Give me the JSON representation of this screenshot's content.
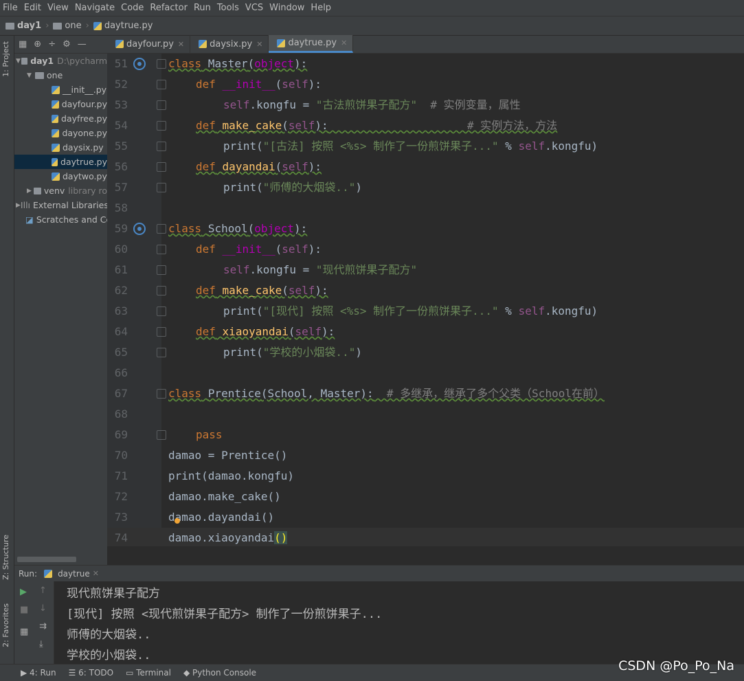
{
  "menu": [
    "File",
    "Edit",
    "View",
    "Navigate",
    "Code",
    "Refactor",
    "Run",
    "Tools",
    "VCS",
    "Window",
    "Help"
  ],
  "breadcrumb": {
    "project": "day1",
    "folder": "one",
    "file": "daytrue.py"
  },
  "side_tabs": {
    "project": "1: Project",
    "structure": "Z: Structure",
    "favorites": "2: Favorites"
  },
  "tree": [
    {
      "label": "day1",
      "extra": "D:\\pycharm",
      "type": "root"
    },
    {
      "label": "one",
      "type": "folder"
    },
    {
      "label": "__init__.py",
      "type": "file"
    },
    {
      "label": "dayfour.py",
      "type": "file"
    },
    {
      "label": "dayfree.py",
      "type": "file"
    },
    {
      "label": "dayone.py",
      "type": "file"
    },
    {
      "label": "daysix.py",
      "type": "file"
    },
    {
      "label": "daytrue.py",
      "type": "file",
      "selected": true
    },
    {
      "label": "daytwo.py",
      "type": "file"
    },
    {
      "label": "venv",
      "extra": "library ro",
      "type": "folder"
    },
    {
      "label": "External Libraries",
      "type": "lib"
    },
    {
      "label": "Scratches and Co",
      "type": "scratch"
    }
  ],
  "tabs": [
    "dayfour.py",
    "daysix.py",
    "daytrue.py"
  ],
  "active_tab": "daytrue.py",
  "line_numbers": [
    "51",
    "52",
    "53",
    "54",
    "55",
    "56",
    "57",
    "58",
    "59",
    "60",
    "61",
    "62",
    "63",
    "64",
    "65",
    "66",
    "67",
    "68",
    "69",
    "70",
    "71",
    "72",
    "73",
    "74"
  ],
  "console": {
    "run_label": "Run:",
    "run_config": "daytrue",
    "lines": [
      "现代煎饼果子配方",
      "[现代] 按照 <现代煎饼果子配方> 制作了一份煎饼果子...",
      "师傅的大烟袋..",
      "学校的小烟袋.."
    ]
  },
  "status_tabs": [
    "4: Run",
    "6: TODO",
    "Terminal",
    "Python Console"
  ],
  "watermark": "CSDN @Po_Po_Na",
  "colors": {
    "keyword": "#cc7832",
    "function": "#ffc66d",
    "self": "#94558d",
    "string": "#6a8759",
    "comment": "#808080",
    "accent": "#4a88c7"
  },
  "code": {
    "l51": {
      "kw": "class",
      "name": "Master",
      "open": "(",
      "base": "object",
      "close": "):"
    },
    "l52": {
      "kw": "def",
      "name": "__init__",
      "open": "(",
      "self": "self",
      "close": "):"
    },
    "l53": {
      "self": "self",
      "attr": ".kongfu = ",
      "str": "\"古法煎饼果子配方\"",
      "comment": "  # 实例变量，属性"
    },
    "l54": {
      "kw": "def",
      "name": "make_cake",
      "open": "(",
      "self": "self",
      "close": "):",
      "comment": "                     # 实例方法，方法"
    },
    "l55": {
      "pre": "print(",
      "str": "\"[古法] 按照 <%s> 制作了一份煎饼果子...\"",
      "mid": " % ",
      "self": "self",
      "post": ".kongfu)"
    },
    "l56": {
      "kw": "def",
      "name": "dayandai",
      "open": "(",
      "self": "self",
      "close": "):"
    },
    "l57": {
      "pre": "print(",
      "str": "\"师傅的大烟袋..\"",
      "post": ")"
    },
    "l59": {
      "kw": "class",
      "name": "School",
      "open": "(",
      "base": "object",
      "close": "):"
    },
    "l60": {
      "kw": "def",
      "name": "__init__",
      "open": "(",
      "self": "self",
      "close": "):"
    },
    "l61": {
      "self": "self",
      "attr": ".kongfu = ",
      "str": "\"现代煎饼果子配方\""
    },
    "l62": {
      "kw": "def",
      "name": "make_cake",
      "open": "(",
      "self": "self",
      "close": "):"
    },
    "l63": {
      "pre": "print(",
      "str": "\"[现代] 按照 <%s> 制作了一份煎饼果子...\"",
      "mid": " % ",
      "self": "self",
      "post": ".kongfu)"
    },
    "l64": {
      "kw": "def",
      "name": "xiaoyandai",
      "open": "(",
      "self": "self",
      "close": "):"
    },
    "l65": {
      "pre": "print(",
      "str": "\"学校的小烟袋..\"",
      "post": ")"
    },
    "l67": {
      "kw": "class",
      "name": "Prentice",
      "open": "(School, Master):",
      "comment": "  # 多继承，继承了多个父类（School在前）"
    },
    "l69": {
      "kw": "pass"
    },
    "l70": "damao = Prentice()",
    "l71": "print(damao.kongfu)",
    "l72": "damao.make_cake()",
    "l73": "damao.dayandai()",
    "l74": {
      "pre": "damao.xiaoyandai",
      "paren": "()"
    }
  }
}
